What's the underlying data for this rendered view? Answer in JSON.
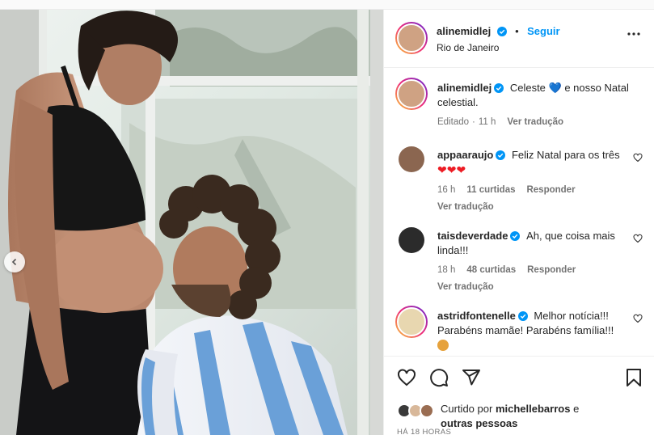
{
  "post": {
    "author": "alinemidlej",
    "follow_label": "Seguir",
    "location": "Rio de Janeiro"
  },
  "caption": {
    "author": "alinemidlej",
    "text_before": "Celeste",
    "emoji": "💙",
    "text_after": "e nosso Natal celestial.",
    "edited_label": "Editado",
    "time": "11 h",
    "see_translation": "Ver tradução"
  },
  "comments": [
    {
      "author": "appaaraujo",
      "text": "Feliz Natal para os três",
      "emoji": "❤❤❤",
      "time": "16 h",
      "likes": "11 curtidas",
      "reply_label": "Responder",
      "see_translation": "Ver tradução"
    },
    {
      "author": "taisdeverdade",
      "text": "Ah, que coisa mais linda!!!",
      "time": "18 h",
      "likes": "48 curtidas",
      "reply_label": "Responder",
      "see_translation": "Ver tradução"
    },
    {
      "author": "astridfontenelle",
      "text": "Melhor notícia!!! Parabéns mamãe! Parabéns família!!!"
    }
  ],
  "likes": {
    "prefix": "Curtido por",
    "user": "michellebarros",
    "and": "e",
    "others": "outras pessoas"
  },
  "timestamp": "HÁ 18 HORAS",
  "colors": {
    "accent": "#0095f6",
    "verified": "#0095f6",
    "muted": "#737373",
    "heart_red": "#ed1c24"
  }
}
